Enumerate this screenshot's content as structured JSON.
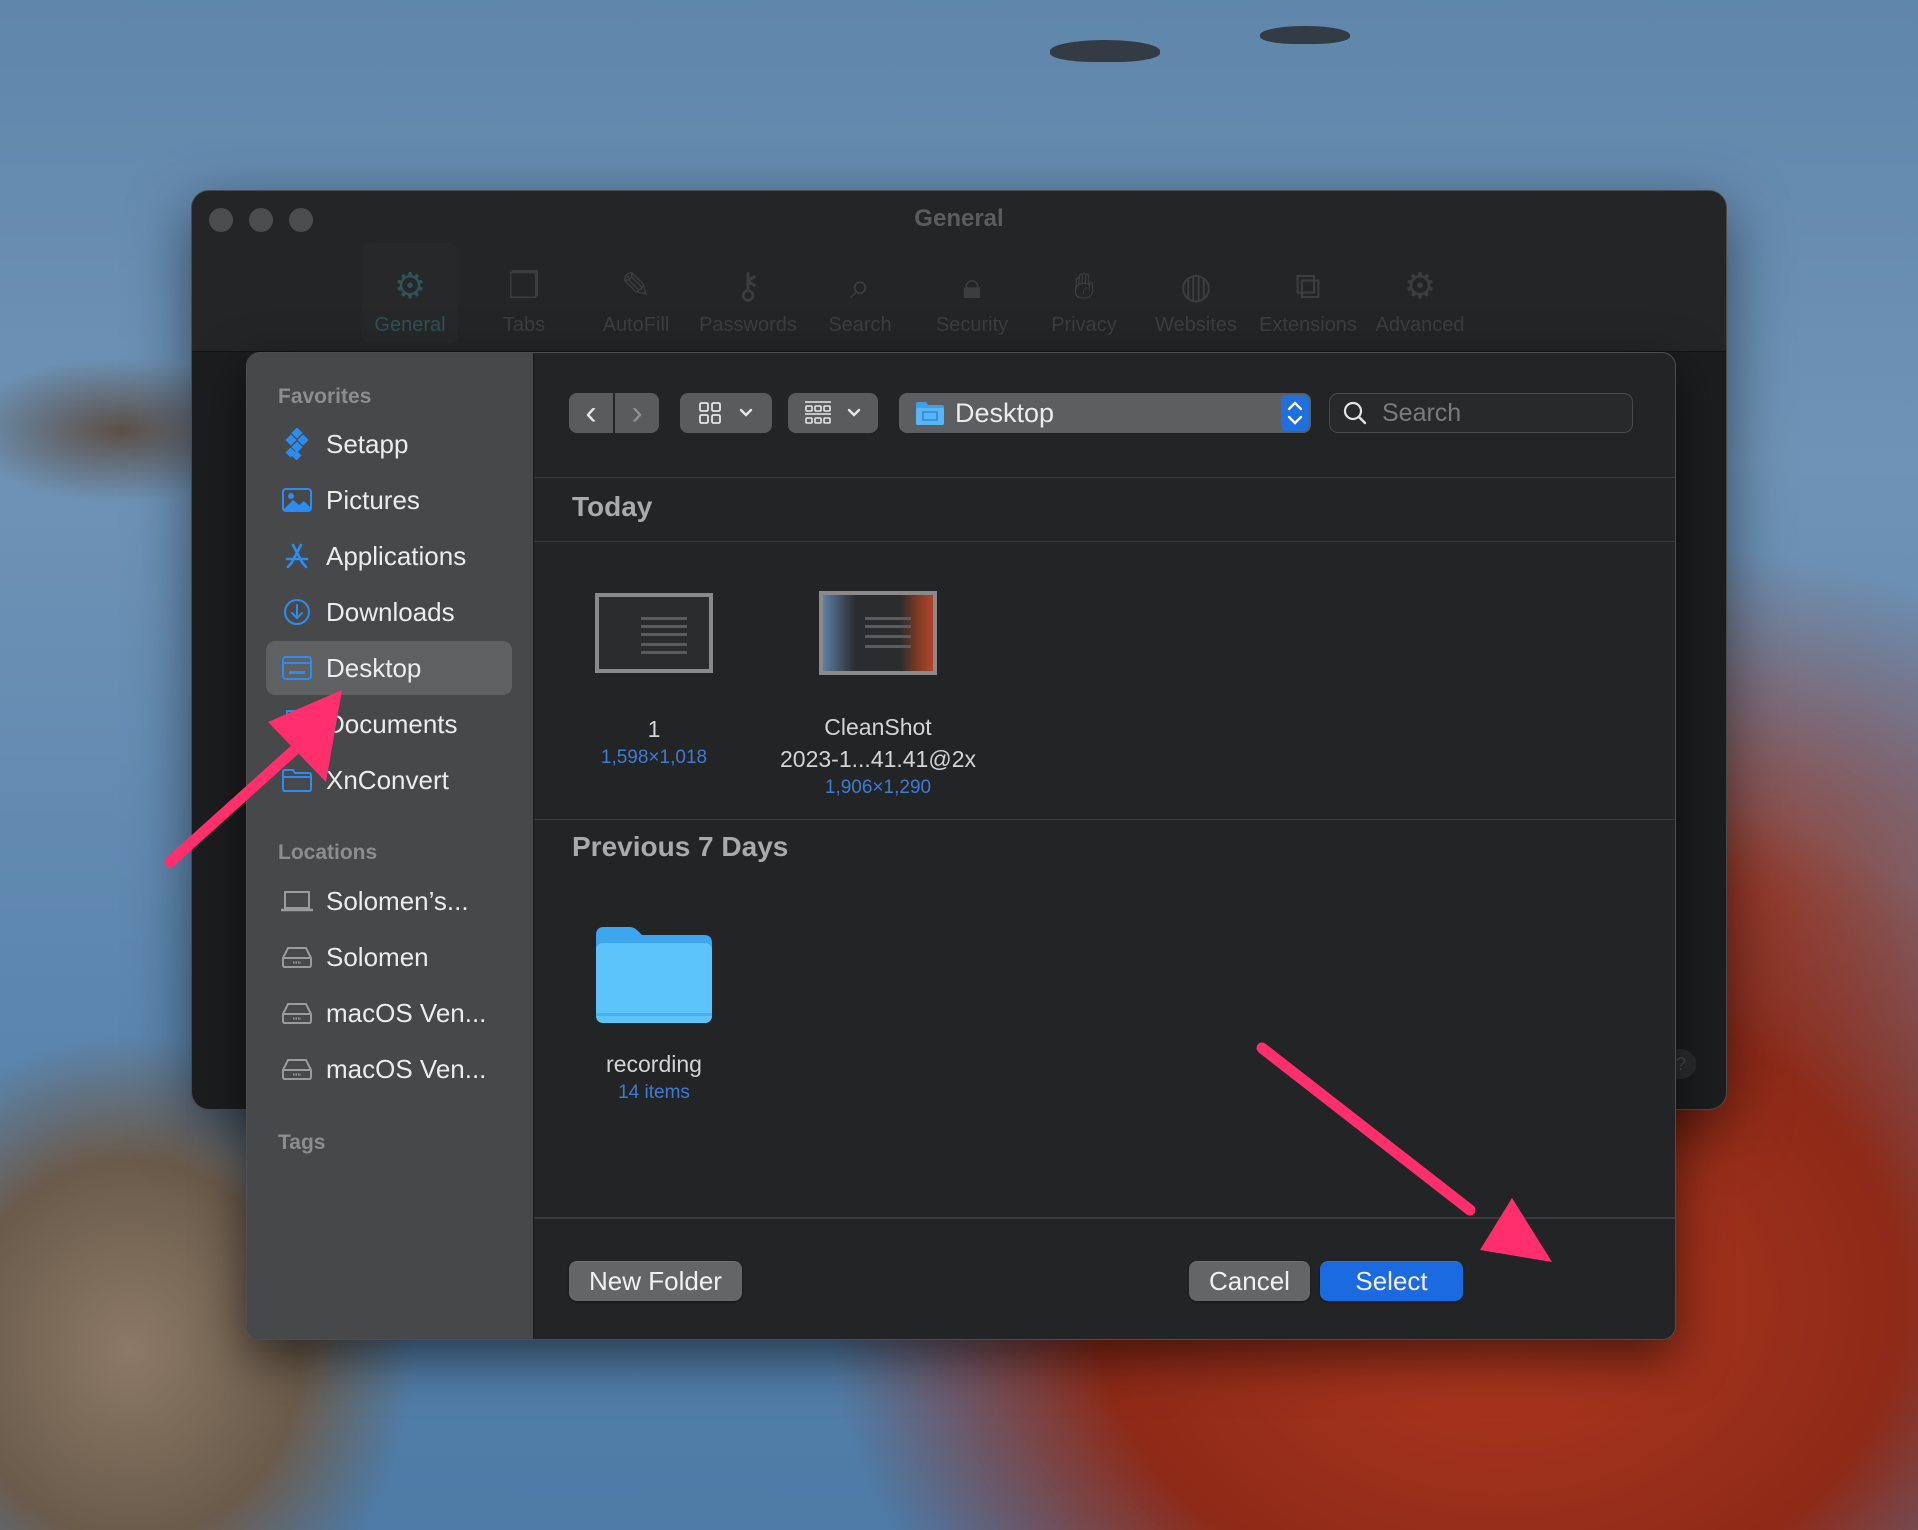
{
  "prefs_window": {
    "title": "General",
    "tabs": [
      {
        "label": "General",
        "icon": "gear-icon",
        "active": true
      },
      {
        "label": "Tabs",
        "icon": "tabs-icon"
      },
      {
        "label": "AutoFill",
        "icon": "autofill-icon"
      },
      {
        "label": "Passwords",
        "icon": "key-icon"
      },
      {
        "label": "Search",
        "icon": "search-icon"
      },
      {
        "label": "Security",
        "icon": "lock-icon"
      },
      {
        "label": "Privacy",
        "icon": "hand-icon"
      },
      {
        "label": "Websites",
        "icon": "globe-icon"
      },
      {
        "label": "Extensions",
        "icon": "puzzle-icon"
      },
      {
        "label": "Advanced",
        "icon": "gears-icon"
      }
    ],
    "help_label": "?"
  },
  "sidebar": {
    "favorites_label": "Favorites",
    "favorites": [
      {
        "label": "Setapp",
        "icon": "setapp-icon"
      },
      {
        "label": "Pictures",
        "icon": "pictures-icon"
      },
      {
        "label": "Applications",
        "icon": "applications-icon"
      },
      {
        "label": "Downloads",
        "icon": "downloads-icon"
      },
      {
        "label": "Desktop",
        "icon": "desktop-icon",
        "selected": true
      },
      {
        "label": "Documents",
        "icon": "documents-icon"
      },
      {
        "label": "XnConvert",
        "icon": "folder-icon"
      }
    ],
    "locations_label": "Locations",
    "locations": [
      {
        "label": "Solomen’s...",
        "icon": "laptop-icon"
      },
      {
        "label": "Solomen",
        "icon": "drive-icon"
      },
      {
        "label": "macOS Ven...",
        "icon": "drive-icon"
      },
      {
        "label": "macOS Ven...",
        "icon": "drive-icon"
      }
    ],
    "tags_label": "Tags"
  },
  "toolbar": {
    "back": "‹",
    "forward": "›",
    "location": "Desktop",
    "search_placeholder": "Search"
  },
  "groups": [
    {
      "title": "Today",
      "items": [
        {
          "name": "1",
          "meta": "1,598×1,018"
        },
        {
          "name": "CleanShot 2023-1...41.41@2x",
          "name_line1": "CleanShot",
          "name_line2": "2023-1...41.41@2x",
          "meta": "1,906×1,290"
        }
      ]
    },
    {
      "title": "Previous 7 Days",
      "items": [
        {
          "name": "recording",
          "meta": "14 items"
        }
      ]
    }
  ],
  "footer": {
    "new_folder": "New Folder",
    "cancel": "Cancel",
    "select": "Select"
  },
  "colors": {
    "accent": "#1b6ae0",
    "sidebar_icon": "#2d8cf0",
    "annotation_arrow": "#ff2f6d"
  }
}
